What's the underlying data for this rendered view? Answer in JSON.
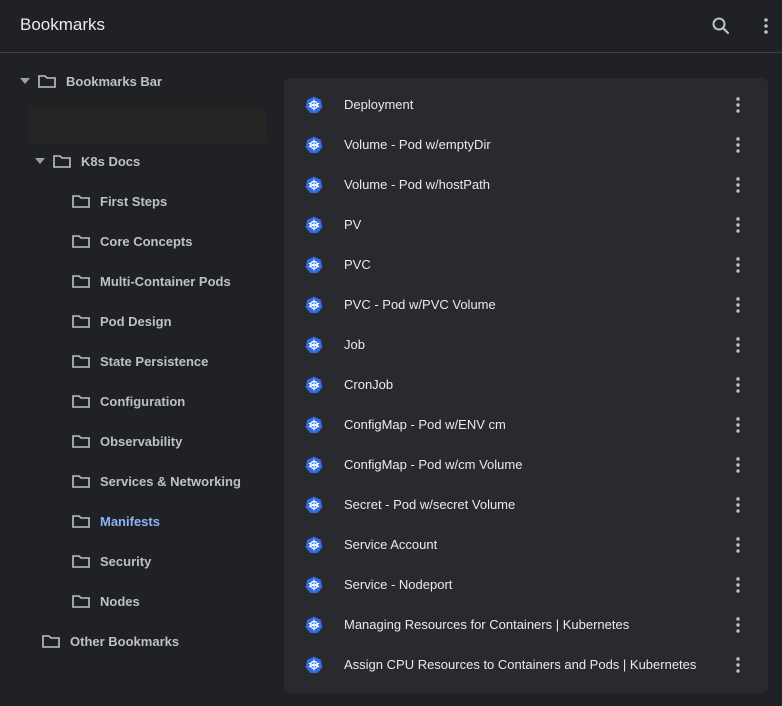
{
  "app": {
    "title": "Bookmarks"
  },
  "icons": {
    "search": "search-icon",
    "menu": "more-vert-icon",
    "folder": "folder-icon",
    "favicon": "kubernetes-icon"
  },
  "colors": {
    "background": "#202124",
    "panel": "#292a2d",
    "selected": "#8ab4f8",
    "favicon": "#326ce5"
  },
  "sidebar": {
    "bookmarks_bar": "Bookmarks Bar",
    "k8s_docs": "K8s Docs",
    "children": [
      {
        "label": "First Steps"
      },
      {
        "label": "Core Concepts"
      },
      {
        "label": "Multi-Container Pods"
      },
      {
        "label": "Pod Design"
      },
      {
        "label": "State Persistence"
      },
      {
        "label": "Configuration"
      },
      {
        "label": "Observability"
      },
      {
        "label": "Services & Networking"
      },
      {
        "label": "Manifests",
        "selected": true
      },
      {
        "label": "Security"
      },
      {
        "label": "Nodes"
      }
    ],
    "other_bookmarks": "Other Bookmarks"
  },
  "bookmarks": [
    {
      "title": "Deployment"
    },
    {
      "title": "Volume - Pod w/emptyDir"
    },
    {
      "title": "Volume - Pod w/hostPath"
    },
    {
      "title": "PV"
    },
    {
      "title": "PVC"
    },
    {
      "title": "PVC - Pod w/PVC Volume"
    },
    {
      "title": "Job"
    },
    {
      "title": "CronJob"
    },
    {
      "title": "ConfigMap - Pod w/ENV cm"
    },
    {
      "title": "ConfigMap - Pod w/cm Volume"
    },
    {
      "title": "Secret - Pod w/secret Volume"
    },
    {
      "title": "Service Account"
    },
    {
      "title": "Service - Nodeport"
    },
    {
      "title": "Managing Resources for Containers | Kubernetes"
    },
    {
      "title": "Assign CPU Resources to Containers and Pods | Kubernetes"
    }
  ]
}
